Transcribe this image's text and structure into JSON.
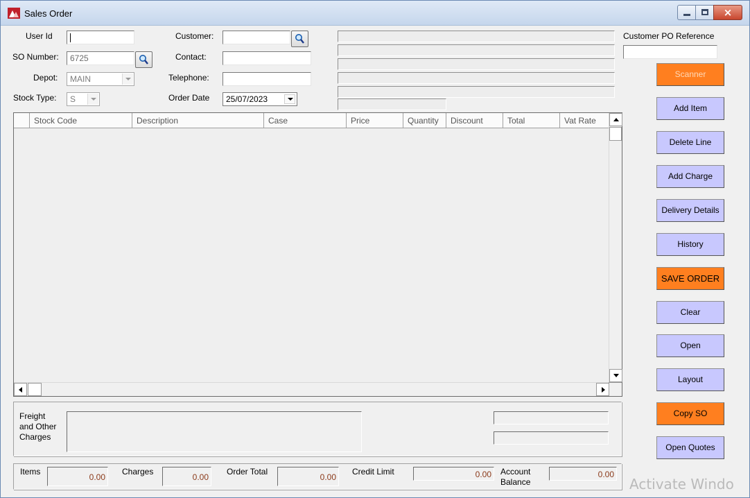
{
  "window": {
    "title": "Sales Order",
    "icon": "app-logo-icon",
    "close_glyph": "×"
  },
  "header": {
    "user_id": {
      "label": "User Id",
      "value": ""
    },
    "so_number": {
      "label": "SO Number:",
      "value": "6725"
    },
    "depot": {
      "label": "Depot:",
      "value": "MAIN"
    },
    "stock_type": {
      "label": "Stock Type:",
      "value": "S"
    },
    "customer": {
      "label": "Customer:",
      "value": ""
    },
    "contact": {
      "label": "Contact:",
      "value": ""
    },
    "telephone": {
      "label": "Telephone:",
      "value": ""
    },
    "order_date": {
      "label": "Order Date",
      "value": "25/07/2023"
    },
    "customer_po": {
      "label": "Customer PO Reference",
      "value": ""
    }
  },
  "grid": {
    "columns": [
      "",
      "Stock Code",
      "Description",
      "Case",
      "Price",
      "Quantity",
      "Discount",
      "Total",
      "Vat Rate"
    ]
  },
  "buttons": {
    "scanner": "Scanner",
    "add_item": "Add Item",
    "delete_line": "Delete Line",
    "add_charge": "Add Charge",
    "delivery_details": "Delivery Details",
    "history": "History",
    "save_order": "SAVE ORDER",
    "clear": "Clear",
    "open": "Open",
    "layout": "Layout",
    "copy_so": "Copy SO",
    "open_quotes": "Open Quotes"
  },
  "charges": {
    "label_line1": "Freight",
    "label_line2": "and Other",
    "label_line3": "Charges"
  },
  "totals": {
    "items": {
      "label": "Items",
      "value": "0.00"
    },
    "charges": {
      "label": "Charges",
      "value": "0.00"
    },
    "order_total": {
      "label": "Order Total",
      "value": "0.00"
    },
    "credit_limit": {
      "label": "Credit Limit",
      "value": "0.00"
    },
    "account_balance": {
      "label_line1": "Account",
      "label_line2": "Balance",
      "value": "0.00"
    }
  },
  "watermark": "Activate Windo",
  "colors": {
    "button_blue": "#c8c8fe",
    "button_orange": "#ff7f1f",
    "amount_text": "#8b3a1a"
  }
}
